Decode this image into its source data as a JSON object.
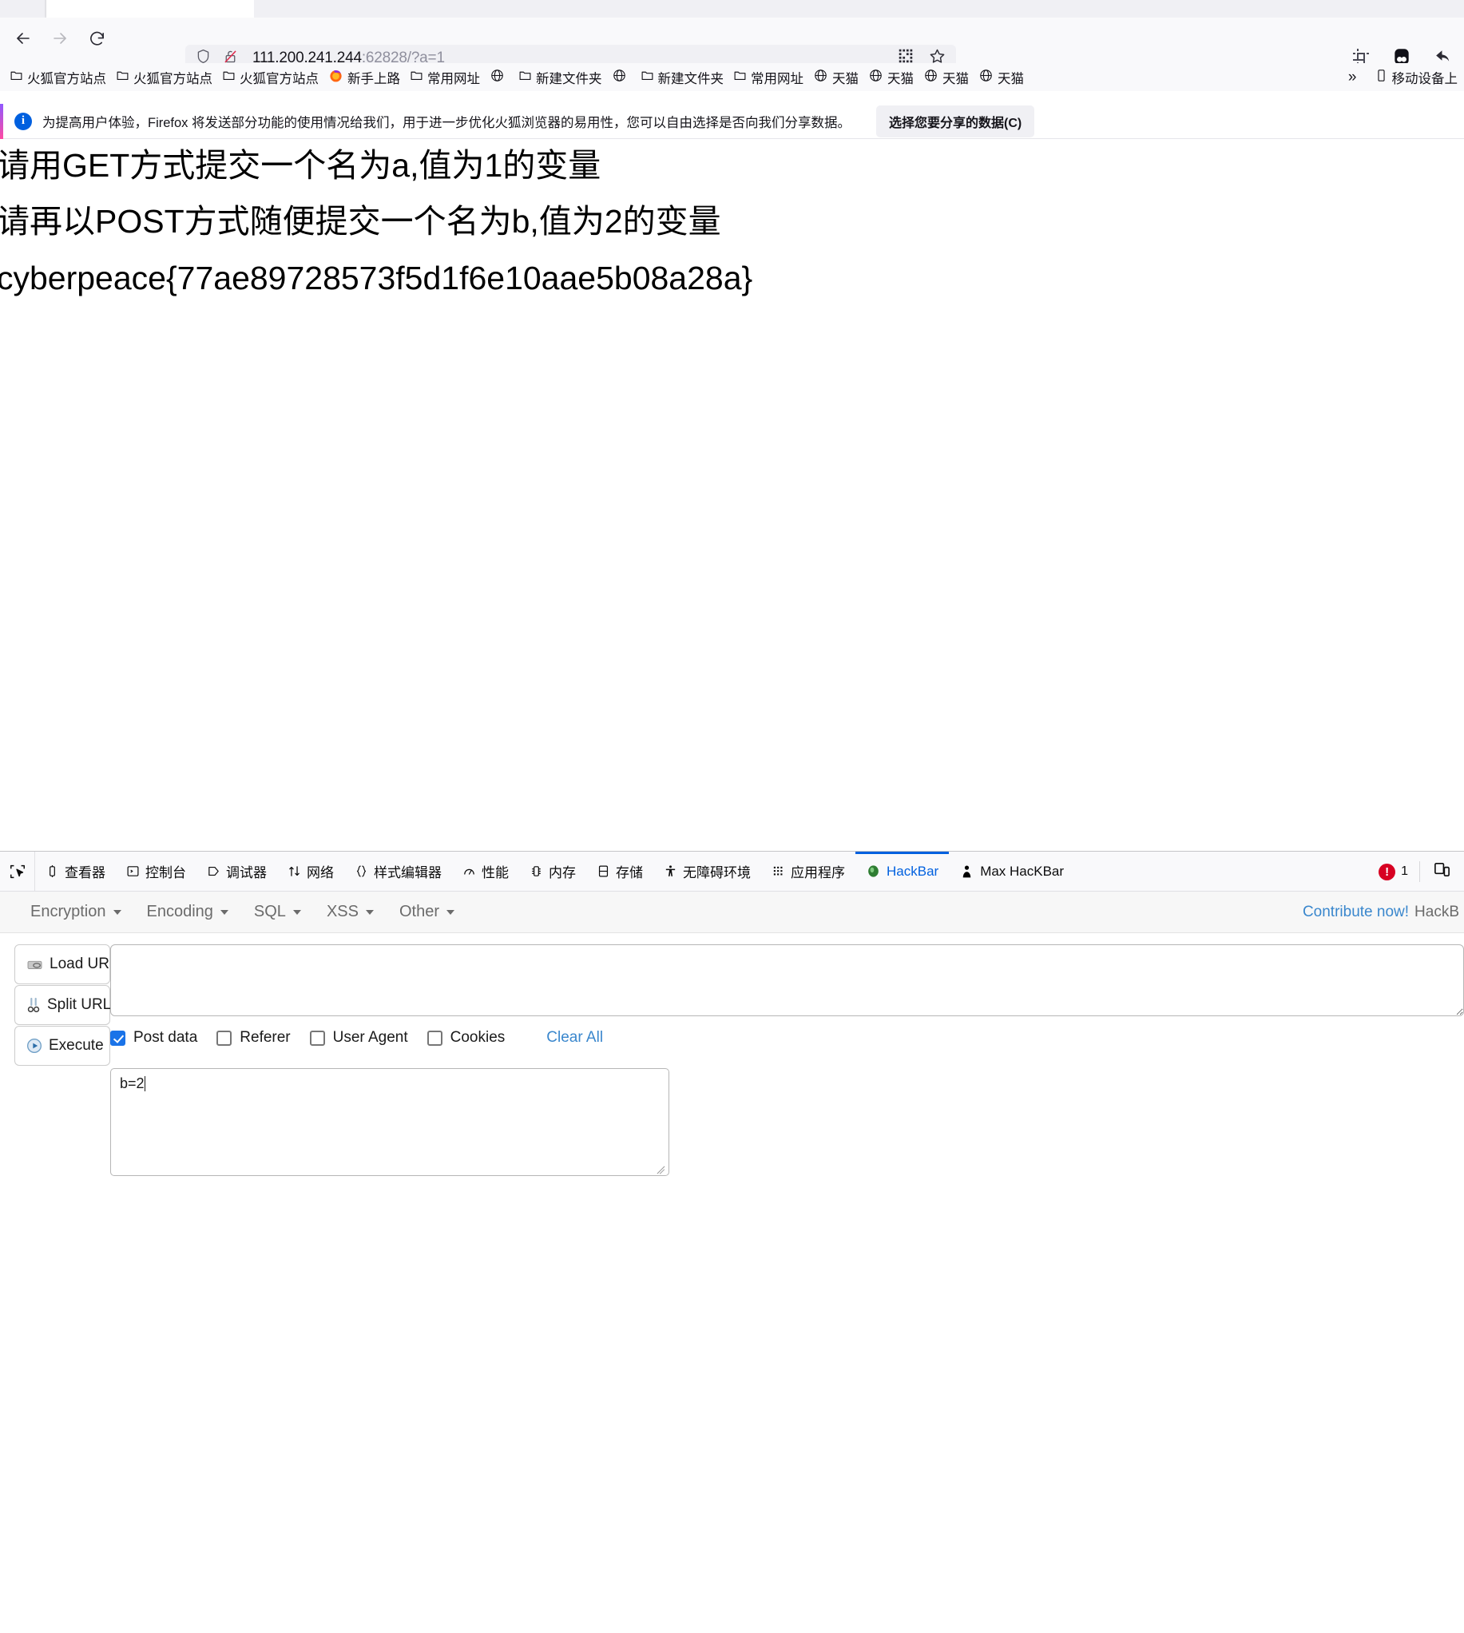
{
  "browser": {
    "nav": {
      "back_icon": "arrow-left-icon",
      "forward_icon": "arrow-right-icon",
      "reload_icon": "reload-icon"
    },
    "urlbar": {
      "shield_icon": "shield-icon",
      "lock_broken_icon": "lock-broken-icon",
      "host": "111.200.241.244",
      "rest": ":62828/?a=1",
      "qrcode_icon": "qrcode-icon",
      "bookmark_star_icon": "star-icon"
    },
    "toolbar_right": [
      {
        "icon": "screenshot-crop-icon",
        "name": "screenshot-button"
      },
      {
        "icon": "panda-extension-icon",
        "name": "extension-button"
      },
      {
        "icon": "undo-arrow-icon",
        "name": "undo-button"
      }
    ],
    "bookmarks": [
      {
        "icon": "folder-icon",
        "label": "火狐官方站点"
      },
      {
        "icon": "folder-icon",
        "label": "火狐官方站点"
      },
      {
        "icon": "folder-icon",
        "label": "火狐官方站点"
      },
      {
        "icon": "firefox-icon",
        "label": "新手上路"
      },
      {
        "icon": "folder-icon",
        "label": "常用网址"
      },
      {
        "icon": "globe-icon",
        "label": ""
      },
      {
        "icon": "folder-icon",
        "label": "新建文件夹"
      },
      {
        "icon": "globe-icon",
        "label": ""
      },
      {
        "icon": "folder-icon",
        "label": "新建文件夹"
      },
      {
        "icon": "folder-icon",
        "label": "常用网址"
      },
      {
        "icon": "globe-icon",
        "label": "天猫"
      },
      {
        "icon": "globe-icon",
        "label": "天猫"
      },
      {
        "icon": "globe-icon",
        "label": "天猫"
      },
      {
        "icon": "globe-icon",
        "label": "天猫"
      }
    ],
    "bookmarks_overflow_icon": "chevron-double-right-icon",
    "bookmarks_overflow_item": {
      "icon": "mobile-device-icon",
      "label": "移动设备上"
    }
  },
  "notification": {
    "info_icon": "info-icon",
    "message": "为提高用户体验，Firefox 将发送部分功能的使用情况给我们，用于进一步优化火狐浏览器的易用性，您可以自由选择是否向我们分享数据。",
    "button_label": "选择您要分享的数据(C)"
  },
  "page": {
    "line1": "请用GET方式提交一个名为a,值为1的变量",
    "line2": "请再以POST方式随便提交一个名为b,值为2的变量",
    "line3": "cyberpeace{77ae89728573f5d1f6e10aae5b08a28a}"
  },
  "devtools": {
    "picker_icon": "element-picker-icon",
    "tabs": [
      {
        "icon": "inspector-icon",
        "label": "查看器",
        "active": false
      },
      {
        "icon": "console-icon",
        "label": "控制台",
        "active": false
      },
      {
        "icon": "debugger-icon",
        "label": "调试器",
        "active": false
      },
      {
        "icon": "network-icon",
        "label": "网络",
        "active": false
      },
      {
        "icon": "style-editor-icon",
        "label": "样式编辑器",
        "active": false
      },
      {
        "icon": "performance-icon",
        "label": "性能",
        "active": false
      },
      {
        "icon": "memory-icon",
        "label": "内存",
        "active": false
      },
      {
        "icon": "storage-icon",
        "label": "存储",
        "active": false
      },
      {
        "icon": "accessibility-icon",
        "label": "无障碍环境",
        "active": false
      },
      {
        "icon": "application-icon",
        "label": "应用程序",
        "active": false
      },
      {
        "icon": "hackbar-icon",
        "label": "HackBar",
        "active": true
      },
      {
        "icon": "max-hackbar-icon",
        "label": "Max HacKBar",
        "active": false
      }
    ],
    "error_icon": "error-circle-icon",
    "error_count": "1",
    "responsive_icon": "responsive-design-mode-icon",
    "accent_color": "#0060df",
    "error_color": "#d70022"
  },
  "hackbar": {
    "menus": [
      {
        "label": "Encryption"
      },
      {
        "label": "Encoding"
      },
      {
        "label": "SQL"
      },
      {
        "label": "XSS"
      },
      {
        "label": "Other"
      }
    ],
    "contribute_link": "Contribute now!",
    "contribute_trail": "HackB",
    "buttons": [
      {
        "icon": "load-url-icon",
        "label": "Load URL"
      },
      {
        "icon": "split-url-icon",
        "label": "Split URL"
      },
      {
        "icon": "execute-icon",
        "label": "Execute"
      }
    ],
    "url_input_value": "",
    "url_input_placeholder": "",
    "checkboxes": [
      {
        "label": "Post data",
        "checked": true
      },
      {
        "label": "Referer",
        "checked": false
      },
      {
        "label": "User Agent",
        "checked": false
      },
      {
        "label": "Cookies",
        "checked": false
      }
    ],
    "clear_all_label": "Clear All",
    "post_data_value": "b=2",
    "link_color": "#3a87cd"
  }
}
